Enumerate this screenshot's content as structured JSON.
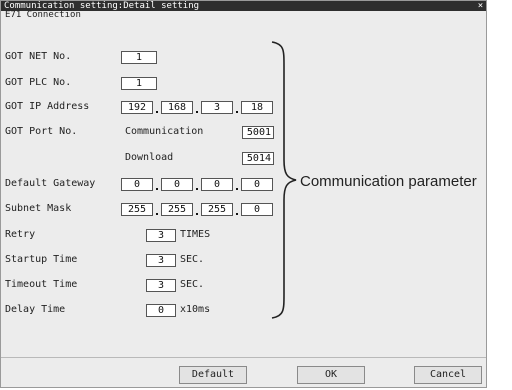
{
  "titlebar": {
    "title": "Communication setting:Detail setting",
    "close": "×"
  },
  "subtitle": "E71 Connection",
  "fields": {
    "got_net_no": {
      "label": "GOT NET No.",
      "value": "1"
    },
    "got_plc_no": {
      "label": "GOT PLC No.",
      "value": "1"
    },
    "got_ip": {
      "label": "GOT IP Address",
      "octets": [
        "192",
        "168",
        "3",
        "18"
      ]
    },
    "got_port": {
      "label": "GOT Port No.",
      "communication_label": "Communication",
      "communication_value": "5001",
      "download_label": "Download",
      "download_value": "5014"
    },
    "default_gateway": {
      "label": "Default Gateway",
      "octets": [
        "0",
        "0",
        "0",
        "0"
      ]
    },
    "subnet_mask": {
      "label": "Subnet Mask",
      "octets": [
        "255",
        "255",
        "255",
        "0"
      ]
    },
    "retry": {
      "label": "Retry",
      "value": "3",
      "unit": "TIMES"
    },
    "startup_time": {
      "label": "Startup Time",
      "value": "3",
      "unit": "SEC."
    },
    "timeout_time": {
      "label": "Timeout Time",
      "value": "3",
      "unit": "SEC."
    },
    "delay_time": {
      "label": "Delay Time",
      "value": "0",
      "unit": "x10ms"
    }
  },
  "annotation": "Communication parameter",
  "buttons": {
    "default": "Default",
    "ok": "OK",
    "cancel": "Cancel"
  }
}
